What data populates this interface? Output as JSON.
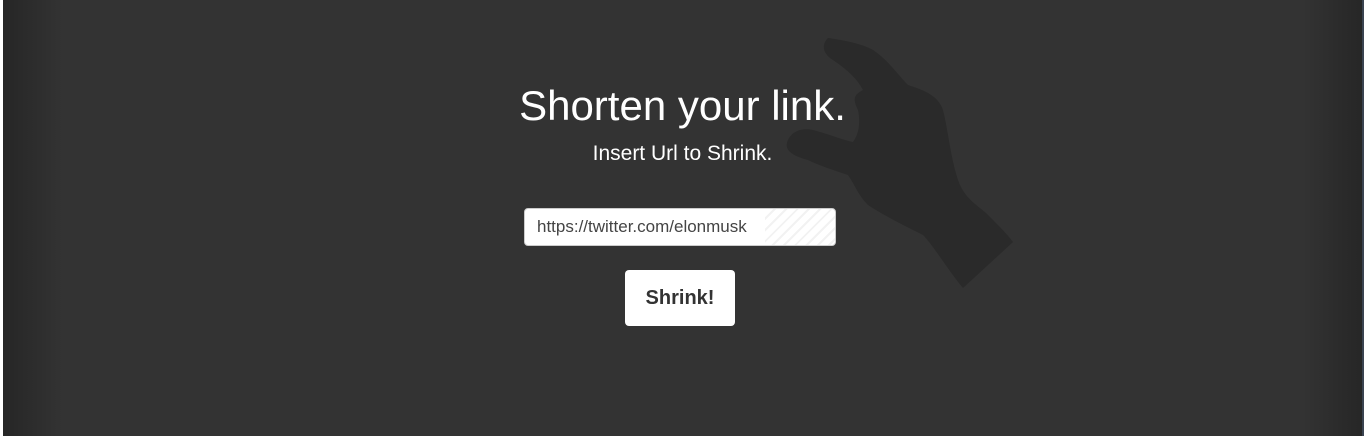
{
  "hero": {
    "title": "Shorten your link.",
    "subtitle": "Insert Url to Shrink."
  },
  "form": {
    "url_value": "https://twitter.com/elonmusk",
    "submit_label": "Shrink!"
  },
  "colors": {
    "background": "#333333",
    "text": "#ffffff",
    "button_bg": "#ffffff",
    "button_text": "#333333"
  },
  "icons": {
    "background_graphic": "hand-silhouette-icon"
  }
}
